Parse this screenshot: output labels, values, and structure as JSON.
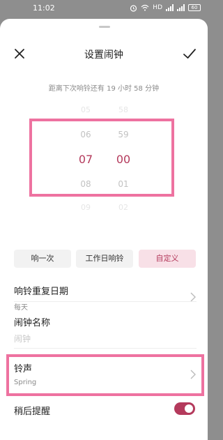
{
  "status_bar": {
    "time": "11:02",
    "icons": [
      "alarm-icon",
      "wifi-icon",
      "hd-icon",
      "signal-icon",
      "signal-icon",
      "battery-icon"
    ],
    "battery_level": "60"
  },
  "header": {
    "title": "设置闹钟",
    "close_icon": "close-icon",
    "confirm_icon": "check-icon"
  },
  "countdown_text": "距离下次响铃还有 19 小时 58 分钟",
  "time_picker": {
    "hours": [
      "05",
      "06",
      "07",
      "08",
      "09"
    ],
    "minutes": [
      "58",
      "59",
      "00",
      "01",
      "02"
    ],
    "selected_hour": "07",
    "selected_minute": "00"
  },
  "repeat_modes": {
    "once": "响一次",
    "workday": "工作日响铃",
    "custom": "自定义",
    "selected": "自定义"
  },
  "repeat_days": {
    "label": "响铃重复日期",
    "value": "每天"
  },
  "alarm_name": {
    "label": "闹钟名称",
    "placeholder": "闹钟"
  },
  "ringtone": {
    "label": "铃声",
    "value": "Spring"
  },
  "snooze": {
    "label": "稍后提醒",
    "enabled": true
  },
  "colors": {
    "accent": "#b43a5c",
    "highlight": "#ee72a0",
    "selected_mode_bg": "#f8e0e7"
  }
}
